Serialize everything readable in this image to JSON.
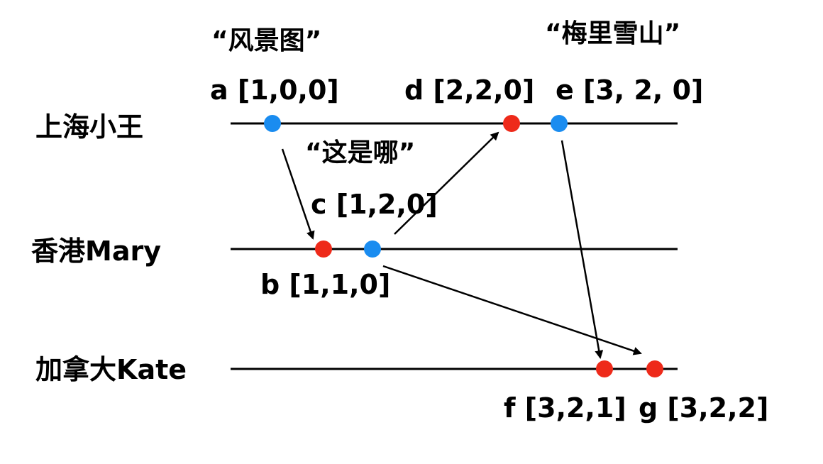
{
  "processes": [
    "上海小王",
    "香港Mary",
    "加拿大Kate"
  ],
  "events": {
    "a": "a [1,0,0]",
    "b": "b [1,1,0]",
    "c": "c [1,2,0]",
    "d": "d [2,2,0]",
    "e": "e [3, 2, 0]",
    "f": "f [3,2,1]",
    "g": "g [3,2,2]"
  },
  "messages": {
    "a": "“风景图”",
    "c": "“这是哪”",
    "e": "“梅里雪山”"
  },
  "colors": {
    "send": "#1a8cf0",
    "receive": "#ee2a1a",
    "line": "#000000"
  }
}
